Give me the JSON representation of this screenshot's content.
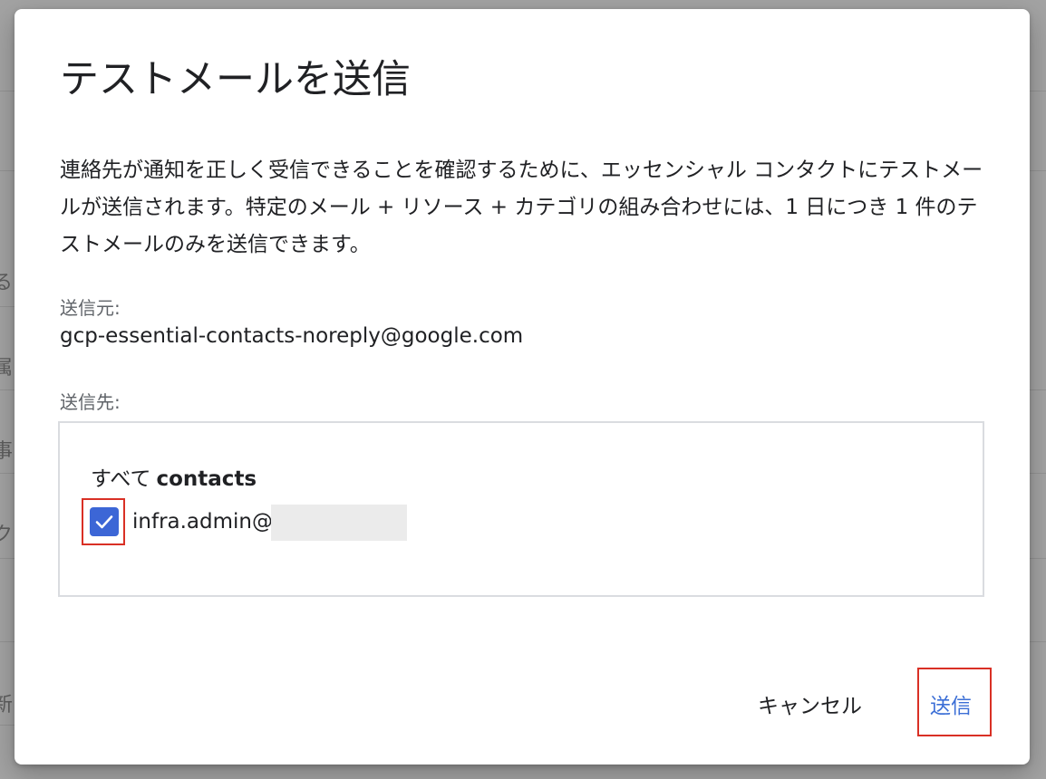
{
  "background": {
    "fragments": [
      "る",
      "属",
      "事",
      "ク",
      "新"
    ]
  },
  "dialog": {
    "title": "テストメールを送信",
    "description": "連絡先が通知を正しく受信できることを確認するために、エッセンシャル コンタクトにテストメールが送信されます。特定のメール + リソース + カテゴリの組み合わせには、1 日につき 1 件のテストメールのみを送信できます。",
    "from_label": "送信元:",
    "from_value": "gcp-essential-contacts-noreply@google.com",
    "to_label": "送信先:",
    "recipients": {
      "all_label_prefix": "すべて",
      "all_label_strong": "contacts",
      "contact": {
        "email_prefix": "infra.admin@",
        "checked": true
      }
    },
    "buttons": {
      "cancel": "キャンセル",
      "send": "送信"
    }
  },
  "colors": {
    "accent": "#3c66d6",
    "send_text": "#3c6fd6",
    "highlight_border": "#d93025"
  }
}
